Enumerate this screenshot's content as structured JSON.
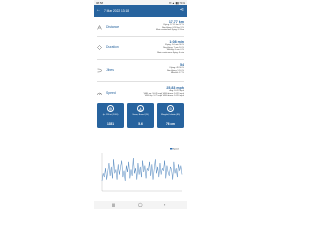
{
  "status_bar": {
    "time": "08:58",
    "icons": "✉ ▲ ▮▮ 71%"
  },
  "app_bar": {
    "title": "7 Mar 2022 13:18",
    "back_icon": "arrow-back-icon",
    "share_icon": "share-icon"
  },
  "stats": [
    {
      "label": "Distance",
      "icon": "distance-icon",
      "value": "17.77 km",
      "details": [
        "Flying: 17.19 km  97 %",
        "Non-flying: 0.58 km  3 %",
        "Main continuous flying: 0.3 km"
      ]
    },
    {
      "label": "Duration",
      "icon": "duration-icon",
      "value": "1:08 min",
      "details": [
        "Flying: 1:0 min  90 %",
        "Non-flying: 7 min  10 %",
        "Waiting: 0 min  0 %",
        "Main continuous flying: 0 min"
      ]
    },
    {
      "label": "Jibes",
      "icon": "jibes-icon",
      "value": "54",
      "details": [
        "Flying: 49  90 %",
        "Non-flying: 5  10 %",
        "Missed: 4  7 %"
      ]
    },
    {
      "label": "Speed",
      "icon": "speed-icon",
      "value": "25.83 mph",
      "details": [
        "Avg: 16.23 mph",
        "VMG up: 10.45 mph  VMG down: 14.29 mph",
        "VMG up: 9.75 mph  VMG down: 14.20 mph"
      ]
    }
  ],
  "cards": [
    {
      "label": "Jp. 13ft at\n(2019)",
      "value": "1351",
      "icon": "board-icon"
    },
    {
      "label": "Savar, Board\n(19)",
      "value": "5.6",
      "icon": "sail-icon"
    },
    {
      "label": "Wingfoil, Infinite\n(85)",
      "value": "76 cm",
      "icon": "foil-icon"
    }
  ],
  "chart_data": {
    "type": "line",
    "series": [
      {
        "name": "Speed",
        "values": [
          8,
          14,
          11,
          18,
          9,
          16,
          22,
          12,
          19,
          10,
          25,
          14,
          17,
          9,
          21,
          13,
          19,
          24,
          11,
          16,
          8,
          20,
          15,
          23,
          10,
          17,
          12,
          26,
          14,
          18,
          9,
          22,
          13,
          19,
          11,
          24,
          15,
          20,
          10,
          18,
          16,
          23,
          12,
          21,
          9,
          17,
          25,
          14,
          19,
          11,
          22,
          13,
          18,
          16,
          24,
          10,
          20,
          15,
          12,
          19,
          17,
          9,
          23,
          14,
          18,
          11,
          21,
          16,
          20,
          13
        ]
      }
    ],
    "ylim": [
      0,
      30
    ],
    "legend": "top-right",
    "color": "#2b6cb0"
  },
  "nav": {
    "recents": "|||",
    "home": "◯",
    "back": "‹"
  }
}
